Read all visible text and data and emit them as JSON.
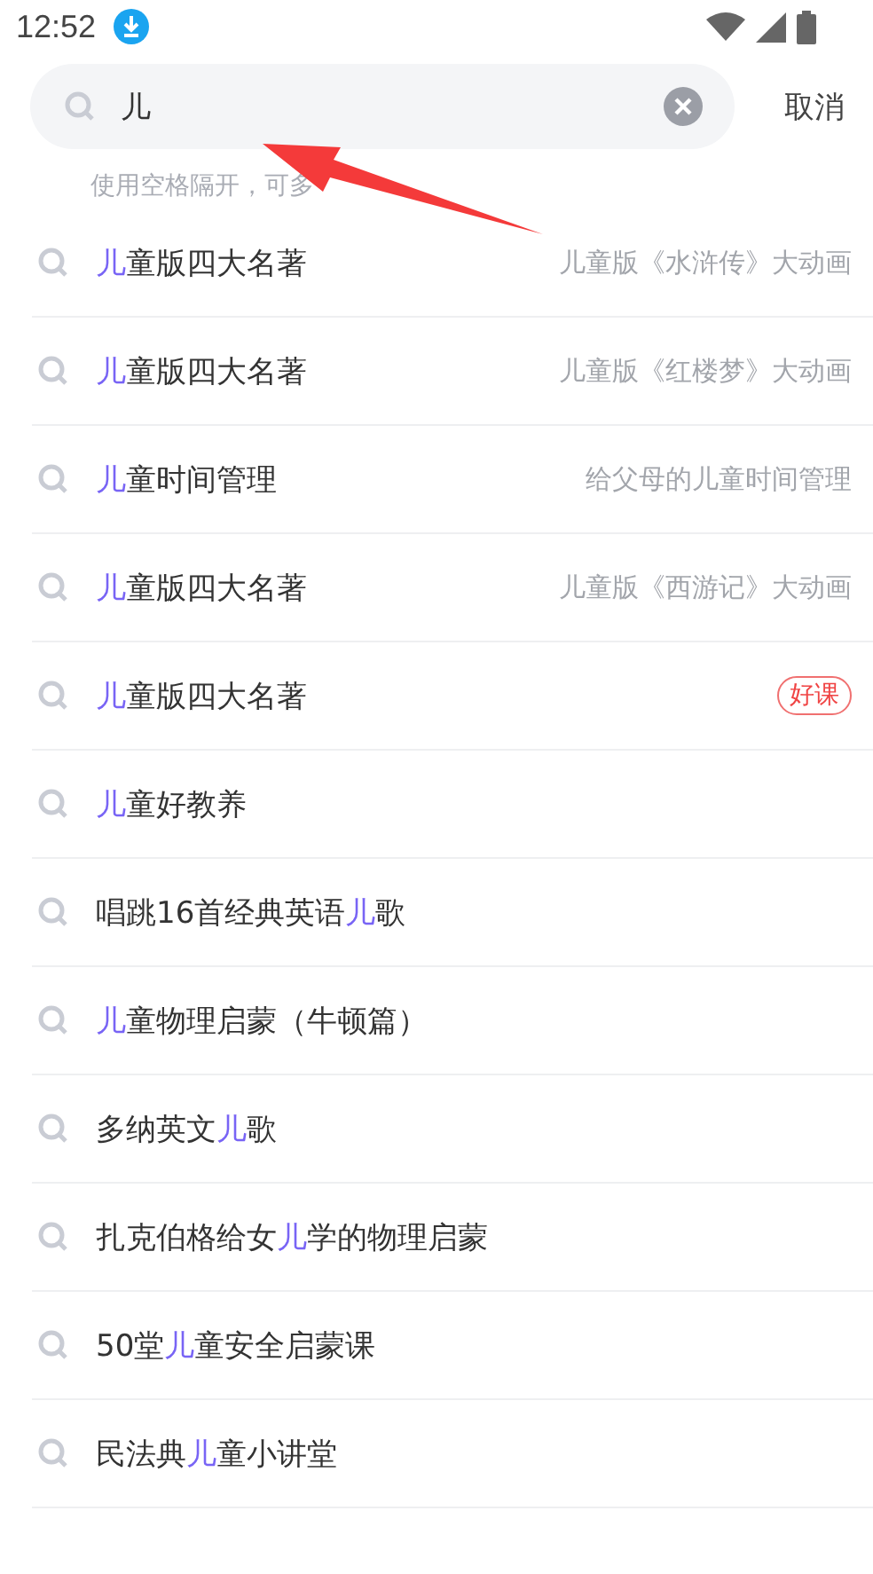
{
  "status_bar": {
    "time": "12:52"
  },
  "search": {
    "value": "儿",
    "cancel": "取消"
  },
  "hint": "使用空格隔开，可多",
  "results": [
    {
      "parts": [
        {
          "text": "儿",
          "highlight": true
        },
        {
          "text": "童版四大名著",
          "highlight": false
        }
      ],
      "kind": "subtitle",
      "subtitle": "儿童版《水浒传》大动画"
    },
    {
      "parts": [
        {
          "text": "儿",
          "highlight": true
        },
        {
          "text": "童版四大名著",
          "highlight": false
        }
      ],
      "kind": "subtitle",
      "subtitle": "儿童版《红楼梦》大动画"
    },
    {
      "parts": [
        {
          "text": "儿",
          "highlight": true
        },
        {
          "text": "童时间管理",
          "highlight": false
        }
      ],
      "kind": "subtitle",
      "subtitle": "给父母的儿童时间管理"
    },
    {
      "parts": [
        {
          "text": "儿",
          "highlight": true
        },
        {
          "text": "童版四大名著",
          "highlight": false
        }
      ],
      "kind": "subtitle",
      "subtitle": "儿童版《西游记》大动画"
    },
    {
      "parts": [
        {
          "text": "儿",
          "highlight": true
        },
        {
          "text": "童版四大名著",
          "highlight": false
        }
      ],
      "kind": "badge",
      "badge": "好课"
    },
    {
      "parts": [
        {
          "text": "儿",
          "highlight": true
        },
        {
          "text": "童好教养",
          "highlight": false
        }
      ],
      "kind": "plain"
    },
    {
      "parts": [
        {
          "text": "唱跳16首经典英语",
          "highlight": false
        },
        {
          "text": "儿",
          "highlight": true
        },
        {
          "text": "歌",
          "highlight": false
        }
      ],
      "kind": "plain"
    },
    {
      "parts": [
        {
          "text": "儿",
          "highlight": true
        },
        {
          "text": "童物理启蒙（牛顿篇）",
          "highlight": false
        }
      ],
      "kind": "plain"
    },
    {
      "parts": [
        {
          "text": "多纳英文",
          "highlight": false
        },
        {
          "text": "儿",
          "highlight": true
        },
        {
          "text": "歌",
          "highlight": false
        }
      ],
      "kind": "plain"
    },
    {
      "parts": [
        {
          "text": "扎克伯格给女",
          "highlight": false
        },
        {
          "text": "儿",
          "highlight": true
        },
        {
          "text": "学的物理启蒙",
          "highlight": false
        }
      ],
      "kind": "plain"
    },
    {
      "parts": [
        {
          "text": "50堂",
          "highlight": false
        },
        {
          "text": "儿",
          "highlight": true
        },
        {
          "text": "童安全启蒙课",
          "highlight": false
        }
      ],
      "kind": "plain"
    },
    {
      "parts": [
        {
          "text": "民法典",
          "highlight": false
        },
        {
          "text": "儿",
          "highlight": true
        },
        {
          "text": "童小讲堂",
          "highlight": false
        }
      ],
      "kind": "plain"
    }
  ]
}
